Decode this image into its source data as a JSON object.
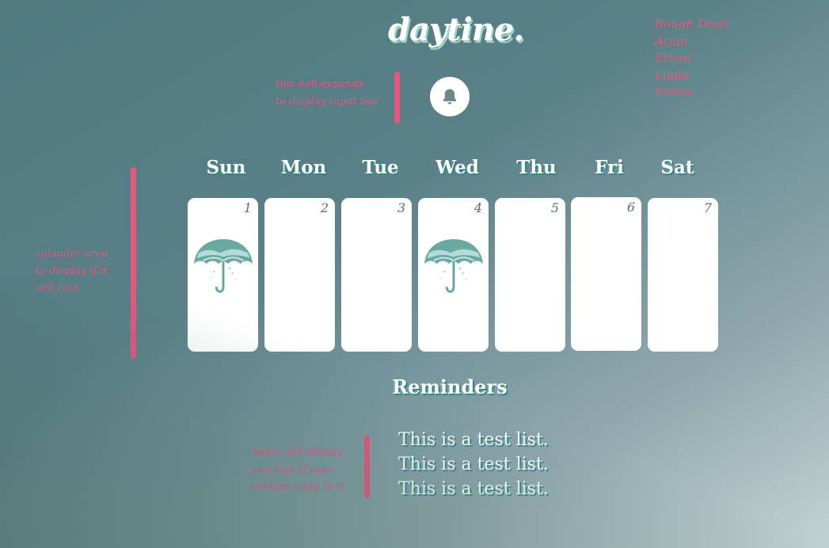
{
  "header": {
    "logo": "daytine."
  },
  "credits": [
    "Rough Draft",
    "Arjun",
    "Ethan",
    "Linda",
    "Vivian"
  ],
  "notes": {
    "bell": [
      "this bell expands",
      "to display input box"
    ],
    "calendar": [
      "calander area",
      "to display if it",
      "will rain"
    ],
    "reminders": [
      "items will display",
      "any tags if user",
      "assigns a tag to it"
    ]
  },
  "bell": {
    "icon": "bell-icon"
  },
  "calendar": {
    "days": [
      {
        "label": "Sun",
        "date": "1",
        "rain": true
      },
      {
        "label": "Mon",
        "date": "2",
        "rain": false
      },
      {
        "label": "Tue",
        "date": "3",
        "rain": false
      },
      {
        "label": "Wed",
        "date": "4",
        "rain": true
      },
      {
        "label": "Thu",
        "date": "5",
        "rain": false
      },
      {
        "label": "Fri",
        "date": "6",
        "rain": false
      },
      {
        "label": "Sat",
        "date": "7",
        "rain": false
      }
    ],
    "rain_icon": "umbrella-icon"
  },
  "reminders": {
    "title": "Reminders",
    "items": [
      "This is a test list.",
      "This is a test list.",
      "This is a test list."
    ]
  },
  "colors": {
    "accent": "#e8557d",
    "shadow": "#2b8a86",
    "logo_shadow": "#9bd3c0"
  }
}
